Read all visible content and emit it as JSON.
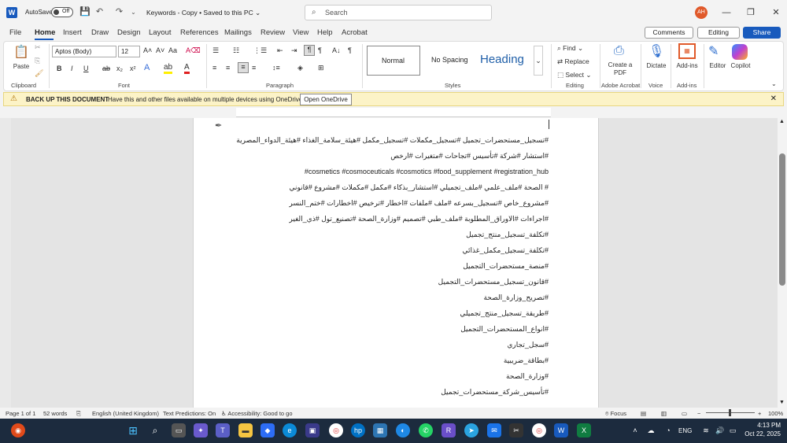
{
  "titlebar": {
    "autosave_label": "AutoSave",
    "autosave_state": "Off",
    "doc_title": "Keywords - Copy • Saved to this PC ⌄",
    "search_placeholder": "Search",
    "avatar_initials": "AH"
  },
  "tabs": [
    "File",
    "Home",
    "Insert",
    "Draw",
    "Design",
    "Layout",
    "References",
    "Mailings",
    "Review",
    "View",
    "Help",
    "Acrobat"
  ],
  "active_tab": "Home",
  "right_buttons": {
    "comments": "Comments",
    "editing": "Editing",
    "share": "Share"
  },
  "ribbon": {
    "paste": "Paste",
    "font_name": "Aptos (Body)",
    "font_size": "12",
    "styles": [
      "Normal",
      "No Spacing",
      "Heading"
    ],
    "find": "Find",
    "replace": "Replace",
    "select": "Select",
    "create_pdf": "Create a PDF",
    "dictate": "Dictate",
    "addins": "Add-ins",
    "editor": "Editor",
    "copilot": "Copilot",
    "group_labels": {
      "clipboard": "Clipboard",
      "font": "Font",
      "paragraph": "Paragraph",
      "styles": "Styles",
      "editing": "Editing",
      "adobe": "Adobe Acrobat",
      "voice": "Voice",
      "addins": "Add-ins"
    }
  },
  "notification": {
    "title": "BACK UP THIS DOCUMENT",
    "message": "Have this and other files available on multiple devices using OneDrive.",
    "button": "Open OneDrive"
  },
  "document": {
    "lines": [
      "#تسجيل_مستحضرات_تجميل #تسجيل_مكملات #تسجيل_مكمل #هيئة_سلامة_الغذاء #هيئة_الدواء_المصرية",
      "#استشار #شركة #تأسيس #تجاحات #متغيرات #ارخص",
      "#cosmetics #cosmoceuticals #cosmotics #food_supplement #registration_hub",
      "# الصحة #ملف_علمي #ملف_تجميلي #استشار_بذكاء #مكمل #مكملات #مشروع #قانوني",
      "#مشروع_خاص #تسجيل_بسرعه #ملف #ملفات #اخطار #ترخيص #اخطارات #ختم_النسر",
      "#اجراءات #الاوراق_المطلوبة #ملف_طبي #تصميم #وزارة_الصحة #تصنيع_تول #ذي_الغير",
      "#تكلفة_تسجيل_منتج_تجميل",
      "#تكلفة_تسجيل_مكمل_غذائي",
      "#منصة_مستحضرات_التجميل",
      "#قانون_تسجيل_مستحضرات_التجميل",
      "#تصريح_وزارة_الصحة",
      "#طريقة_تسجيل_منتج_تجميلي",
      "#انواع_المستحضرات_التجميل",
      "#سجل_تجاري",
      "#بطاقة_ضريبية",
      "#وزارة_الصحة",
      "#تأسيس_شركة_مستحضرات_تجميل"
    ]
  },
  "status": {
    "page": "Page 1 of 1",
    "words": "52 words",
    "language": "English (United Kingdom)",
    "predictions": "Text Predictions: On",
    "accessibility": "Accessibility: Good to go",
    "focus": "Focus",
    "zoom": "100%"
  },
  "taskbar": {
    "time": "4:13 PM",
    "date": "Oct 22, 2025",
    "lang": "ENG"
  },
  "colors": {
    "accent": "#185abd",
    "notif_bg": "#fcf3c7"
  }
}
